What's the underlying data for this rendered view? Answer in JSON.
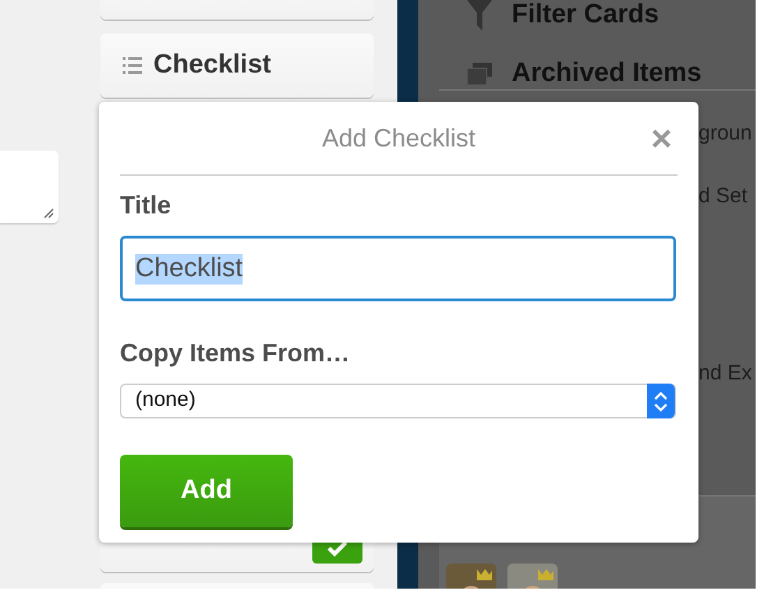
{
  "sidebar_cards": [
    {
      "kind": "blank"
    },
    {
      "kind": "checklist",
      "label": "Checklist"
    }
  ],
  "side_menu": [
    {
      "kind": "filter",
      "label": "Filter Cards"
    },
    {
      "kind": "archive",
      "label": "Archived Items"
    }
  ],
  "menu_fragments": [
    "groun",
    "d Set",
    "nd Ex"
  ],
  "popup": {
    "title": "Add Checklist",
    "close": "×",
    "title_label": "Title",
    "title_value": "Checklist",
    "copy_label": "Copy Items From…",
    "copy_value": "(none)",
    "submit": "Add"
  },
  "subscribe": {
    "checked": true
  }
}
